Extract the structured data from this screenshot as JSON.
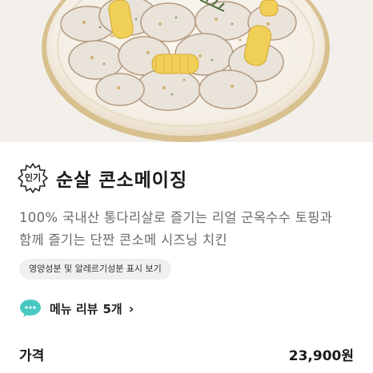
{
  "product": {
    "badge": "인기",
    "name": "순살 콘소메이징",
    "description_line1": "100% 국내산 통다리살로 즐기는 리얼 군옥수수 토핑과",
    "description_line2": "함께 즐기는 단짠 콘소메 시즈닝 치킨",
    "nutrition_link": "영양성분 및 알레르기성분 표시 보기"
  },
  "reviews": {
    "label": "메뉴 리뷰",
    "count": "5개"
  },
  "price": {
    "label": "가격",
    "value": "23,900원"
  },
  "colors": {
    "accent_teal": "#47c9c1",
    "badge_outline": "#222222"
  },
  "icons": {
    "review": "chat-bubble-icon",
    "chevron": "chevron-right-icon",
    "badge": "starburst-badge-icon"
  }
}
